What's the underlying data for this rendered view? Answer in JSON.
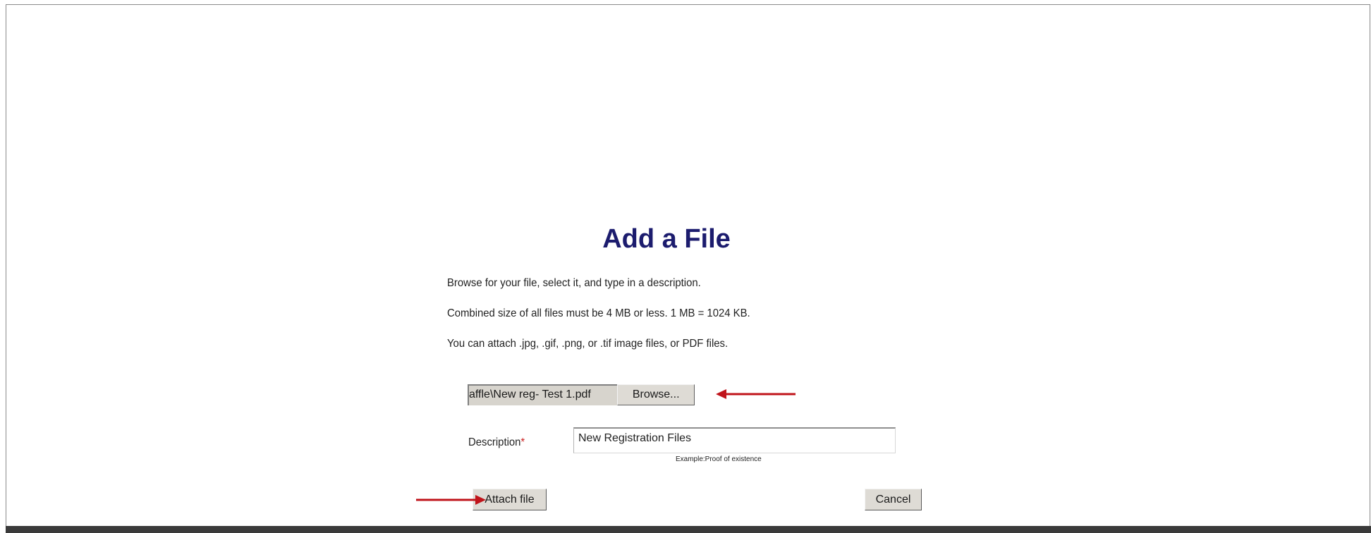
{
  "dialog": {
    "title": "Add a File",
    "instructions": [
      "Browse for your file, select it, and type in a description.",
      "Combined size of all files must be 4 MB or less. 1 MB = 1024 KB.",
      "You can attach .jpg, .gif, .png, or .tif image files, or PDF files."
    ],
    "file_input": {
      "value": "affle\\New reg- Test 1.pdf",
      "browse_label": "Browse..."
    },
    "description": {
      "label": "Description",
      "required_mark": "*",
      "value": "New Registration Files",
      "example": "Example:Proof of existence"
    },
    "buttons": {
      "attach_label": "Attach file",
      "cancel_label": "Cancel"
    }
  },
  "annotations": {
    "arrow_color": "#c0141b"
  },
  "colors": {
    "title": "#1c1c6e",
    "required": "#cc2222",
    "bottom_bar": "#3a3a3a"
  }
}
